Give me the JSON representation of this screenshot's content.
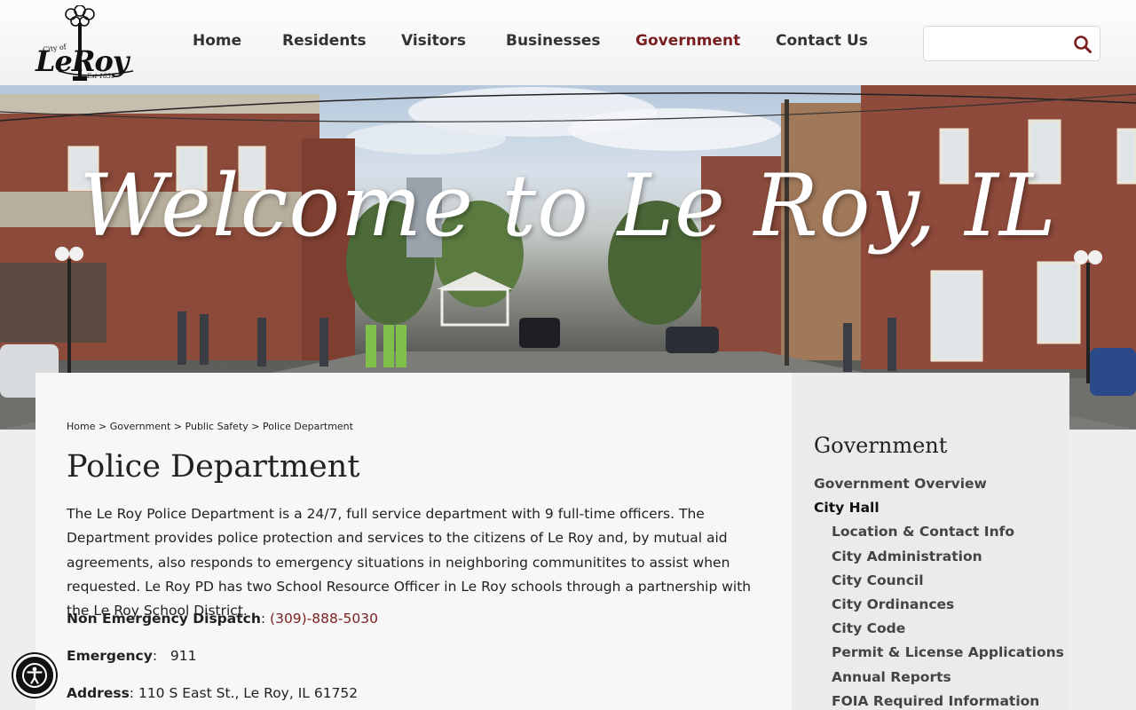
{
  "logo": {
    "city_of": "City of",
    "name": "LeRoy",
    "est": "Est 1835"
  },
  "nav": [
    {
      "label": "Home"
    },
    {
      "label": "Residents"
    },
    {
      "label": "Visitors"
    },
    {
      "label": "Businesses"
    },
    {
      "label": "Government"
    },
    {
      "label": "Contact Us"
    }
  ],
  "active_nav": "Government",
  "search": {
    "placeholder": "",
    "value": "",
    "icon": "search-icon"
  },
  "hero": {
    "title": "Welcome to Le Roy, IL"
  },
  "breadcrumb": [
    "Home",
    "Government",
    "Public Safety",
    "Police Department"
  ],
  "page_title": "Police Department",
  "intro": "The Le Roy Police Department is a 24/7, full service department with 9 full-time officers. The Department provides police protection and services to the citizens of Le Roy and, by mutual aid agreements, also responds to emergency situations in neighboring communitites to assist when requested.  Le Roy PD has two School Resource Officer in Le Roy schools through a partnership with the Le Roy School District.",
  "contact": {
    "non_emergency_label": "Non Emergency Dispatch",
    "non_emergency_value": "(309)-888-5030",
    "emergency_label": "Emergency",
    "emergency_value": "911",
    "address_label": "Address",
    "address_value": "110 S East St., Le Roy, IL 61752"
  },
  "sidebar": {
    "title": "Government",
    "items": [
      {
        "label": "Government Overview"
      },
      {
        "label": "City Hall"
      },
      {
        "label": "Location & Contact Info"
      },
      {
        "label": "City Administration"
      },
      {
        "label": "City Council"
      },
      {
        "label": "City Ordinances"
      },
      {
        "label": "City Code"
      },
      {
        "label": "Permit & License Applications"
      },
      {
        "label": "Annual Reports"
      },
      {
        "label": "FOIA Required Information"
      }
    ]
  },
  "accessibility": {
    "icon": "accessibility-icon"
  },
  "colors": {
    "accent": "#7a1f1f",
    "text": "#222222",
    "sidebar_bg": "#ebebeb",
    "content_bg": "#f7f7f7"
  }
}
